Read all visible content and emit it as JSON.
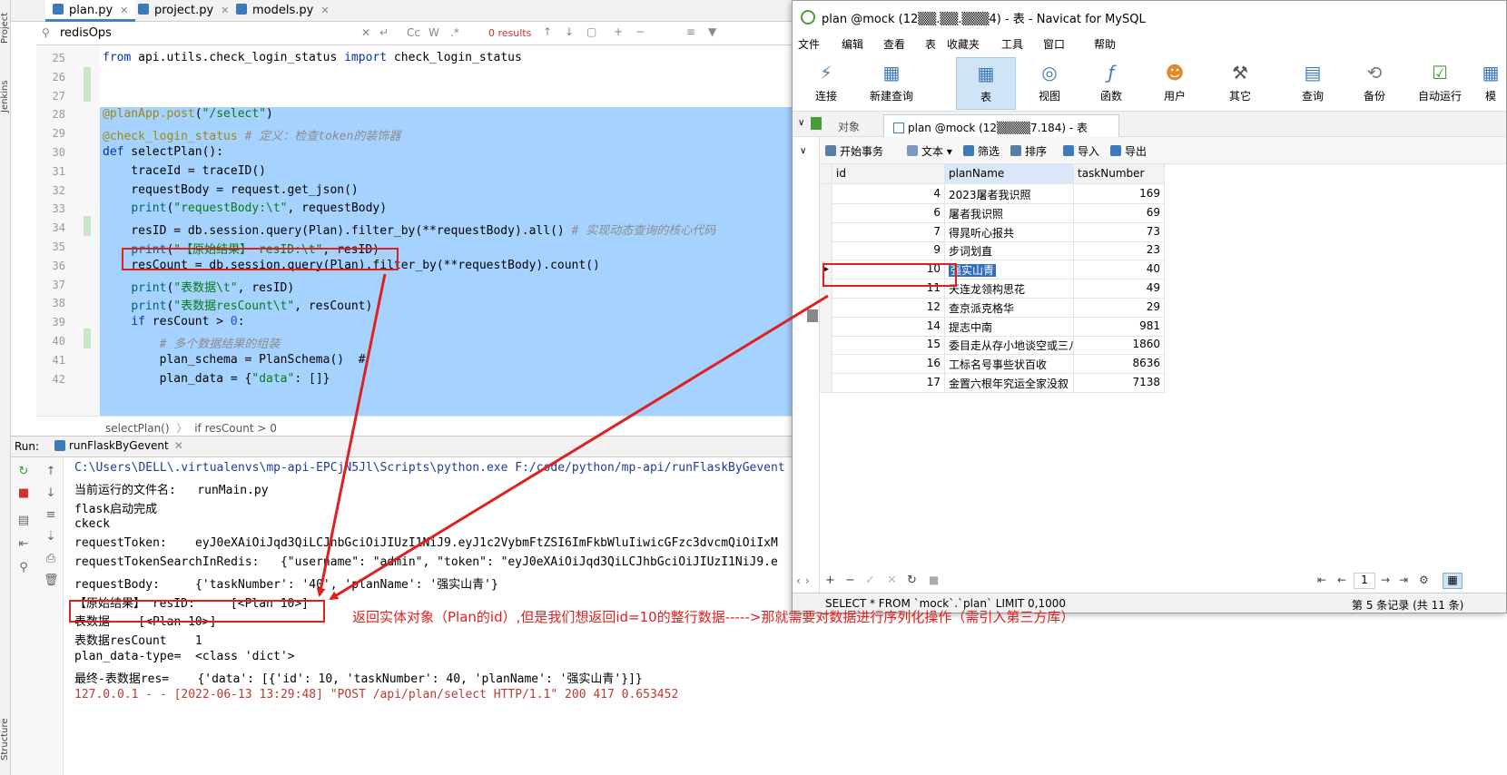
{
  "ide": {
    "file_tabs": [
      "plan.py",
      "project.py",
      "models.py"
    ],
    "side_tabs": [
      "Project",
      "Jenkins",
      "Structure"
    ],
    "search": {
      "value": "redisOps",
      "results": "0 results",
      "cc": "Cc",
      "w": "W",
      "regex": ".*"
    },
    "code_lines": [
      {
        "no": "25",
        "text": "from api.utils.check_login_status import check_login_status"
      },
      {
        "no": "26",
        "text": ""
      },
      {
        "no": "27",
        "text": ""
      },
      {
        "no": "28",
        "text": "@planApp.post(\"/select\")"
      },
      {
        "no": "29",
        "text": "@check_login_status # 定义：检查token的装饰器"
      },
      {
        "no": "30",
        "text": "def selectPlan():"
      },
      {
        "no": "31",
        "text": "    traceId = traceID()"
      },
      {
        "no": "32",
        "text": "    requestBody = request.get_json()"
      },
      {
        "no": "33",
        "text": "    print(\"requestBody:\\t\", requestBody)"
      },
      {
        "no": "34",
        "text": "    resID = db.session.query(Plan).filter_by(**requestBody).all() # 实现动态查询的核心代码"
      },
      {
        "no": "35",
        "text": "    print(\"【原始结果】 resID:\\t\", resID)"
      },
      {
        "no": "36",
        "text": "    resCount = db.session.query(Plan).filter_by(**requestBody).count()"
      },
      {
        "no": "37",
        "text": "    print(\"表数据\\t\", resID)"
      },
      {
        "no": "38",
        "text": "    print(\"表数据resCount\\t\", resCount)"
      },
      {
        "no": "39",
        "text": "    if resCount > 0:"
      },
      {
        "no": "40",
        "text": "        # 多个数据结果的组装"
      },
      {
        "no": "41",
        "text": "        plan_schema = PlanSchema()  #"
      },
      {
        "no": "42",
        "text": "        plan_data = {\"data\": []}"
      }
    ],
    "breadcrumb": [
      "selectPlan()",
      "if resCount > 0"
    ],
    "run": {
      "label": "Run:",
      "config": "runFlaskByGevent",
      "console": [
        "C:\\Users\\DELL\\.virtualenvs\\mp-api-EPCjN5Jl\\Scripts\\python.exe F:/code/python/mp-api/runFlaskByGevent",
        "当前运行的文件名:   runMain.py",
        "flask启动完成",
        "ckeck",
        "requestToken:    eyJ0eXAiOiJqd3QiLCJhbGciOiJIUzI1NiJ9.eyJ1c2VybmFtZSI6ImFkbWluIiwicGFzc3dvcmQiOiIxM",
        "requestTokenSearchInRedis:   {\"username\": \"admin\", \"token\": \"eyJ0eXAiOiJqd3QiLCJhbGciOiJIUzI1NiJ9.e",
        "requestBody:     {'taskNumber': '40', 'planName': '强实山青'}",
        "【原始结果】 resID:     [<Plan 10>]",
        "表数据    [<Plan 10>]",
        "表数据resCount    1",
        "plan_data-type=  <class 'dict'>",
        "最终-表数据res=    {'data': [{'id': 10, 'taskNumber': 40, 'planName': '强实山青'}]}",
        "127.0.0.1 - - [2022-06-13 13:29:48] \"POST /api/plan/select HTTP/1.1\" 200 417 0.653452"
      ]
    }
  },
  "navicat": {
    "title": "plan @mock (12▒▒.▒▒.▒▒▒4) - 表 - Navicat for MySQL",
    "menu": [
      "文件",
      "编辑",
      "查看",
      "表",
      "收藏夹",
      "工具",
      "窗口",
      "帮助"
    ],
    "toolbar": [
      "连接",
      "新建查询",
      "表",
      "视图",
      "函数",
      "用户",
      "其它",
      "查询",
      "备份",
      "自动运行",
      "模"
    ],
    "tabs": [
      "对象",
      "plan @mock (12▒▒▒▒7.184) - 表"
    ],
    "subtoolbar": [
      "开始事务",
      "文本",
      "筛选",
      "排序",
      "导入",
      "导出"
    ],
    "columns": [
      "id",
      "planName",
      "taskNumber"
    ],
    "rows": [
      {
        "id": "4",
        "planName": "2023屠者我识照",
        "taskNumber": "169"
      },
      {
        "id": "6",
        "planName": "屠者我识照",
        "taskNumber": "69"
      },
      {
        "id": "7",
        "planName": "得晁听心报共",
        "taskNumber": "73"
      },
      {
        "id": "9",
        "planName": "步词划直",
        "taskNumber": "23"
      },
      {
        "id": "10",
        "planName": "强实山青",
        "taskNumber": "40"
      },
      {
        "id": "11",
        "planName": "天连龙领构思花",
        "taskNumber": "49"
      },
      {
        "id": "12",
        "planName": "查京派克格华",
        "taskNumber": "29"
      },
      {
        "id": "14",
        "planName": "提志中南",
        "taskNumber": "981"
      },
      {
        "id": "15",
        "planName": "委目走从存小地谈空或三八",
        "taskNumber": "1860"
      },
      {
        "id": "16",
        "planName": "工标名号事些状百收",
        "taskNumber": "8636"
      },
      {
        "id": "17",
        "planName": "金置六根年究运全家没叙",
        "taskNumber": "7138"
      }
    ],
    "page": "1",
    "sql": "SELECT * FROM `mock`.`plan` LIMIT 0,1000",
    "record_status": "第 5 条记录 (共 11 条)"
  },
  "annotation": "返回实体对象（Plan的id）,但是我们想返回id=10的整行数据----->那就需要对数据进行序列化操作（需引入第三方库）",
  "colors": {
    "annotation_red": "#e02020",
    "selection_blue": "#a6d2ff",
    "accent": "#4083c9"
  }
}
